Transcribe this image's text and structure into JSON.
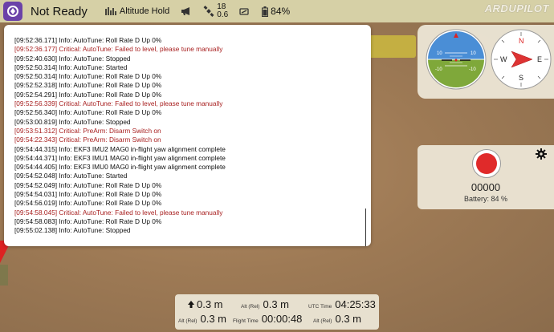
{
  "toolbar": {
    "title": "Not Ready",
    "flight_mode": "Altitude Hold",
    "satellites_top": "18",
    "satellites_bottom": "0.6",
    "battery": "84%",
    "brand": "ARDUPILOT"
  },
  "messages": [
    {
      "text": "[09:52:36.171] Info: AutoTune: Roll Rate D Up 0%",
      "level": "info"
    },
    {
      "text": "[09:52:36.177] Critical: AutoTune: Failed to level, please tune manually",
      "level": "critical"
    },
    {
      "text": "[09:52:40.630] Info: AutoTune: Stopped",
      "level": "info"
    },
    {
      "text": "[09:52:50.314] Info: AutoTune: Started",
      "level": "info"
    },
    {
      "text": "[09:52:50.314] Info: AutoTune: Roll Rate D Up 0%",
      "level": "info"
    },
    {
      "text": "[09:52:52.318] Info: AutoTune: Roll Rate D Up 0%",
      "level": "info"
    },
    {
      "text": "[09:52:54.291] Info: AutoTune: Roll Rate D Up 0%",
      "level": "info"
    },
    {
      "text": "[09:52:56.339] Critical: AutoTune: Failed to level, please tune manually",
      "level": "critical"
    },
    {
      "text": "[09:52:56.340] Info: AutoTune: Roll Rate D Up 0%",
      "level": "info"
    },
    {
      "text": "[09:53:00.819] Info: AutoTune: Stopped",
      "level": "info"
    },
    {
      "text": "[09:53:51.312] Critical: PreArm: Disarm Switch on",
      "level": "critical"
    },
    {
      "text": "[09:54:22.343] Critical: PreArm: Disarm Switch on",
      "level": "critical"
    },
    {
      "text": "[09:54:44.315] Info: EKF3 IMU2 MAG0 in-flight yaw alignment complete",
      "level": "info"
    },
    {
      "text": "[09:54:44.371] Info: EKF3 IMU1 MAG0 in-flight yaw alignment complete",
      "level": "info"
    },
    {
      "text": "[09:54:44.405] Info: EKF3 IMU0 MAG0 in-flight yaw alignment complete",
      "level": "info"
    },
    {
      "text": "[09:54:52.048] Info: AutoTune: Started",
      "level": "info"
    },
    {
      "text": "[09:54:52.049] Info: AutoTune: Roll Rate D Up 0%",
      "level": "info"
    },
    {
      "text": "[09:54:54.031] Info: AutoTune: Roll Rate D Up 0%",
      "level": "info"
    },
    {
      "text": "[09:54:56.019] Info: AutoTune: Roll Rate D Up 0%",
      "level": "info"
    },
    {
      "text": "[09:54:58.045] Critical: AutoTune: Failed to level, please tune manually",
      "level": "critical"
    },
    {
      "text": "[09:54:58.083] Info: AutoTune: Roll Rate D Up 0%",
      "level": "info"
    },
    {
      "text": "[09:55:02.138] Info: AutoTune: Stopped",
      "level": "info"
    }
  ],
  "attitude": {
    "pitch_labels": [
      "10",
      "10",
      "-10",
      "-10"
    ]
  },
  "compass": {
    "directions": [
      "N",
      "E",
      "S",
      "W"
    ]
  },
  "camera": {
    "count": "00000",
    "battery": "Battery: 84 %"
  },
  "telemetry": {
    "climb_value": "0.3 m",
    "alt_label": "Alt (Rel)",
    "alt_value": "0.3 m",
    "utc_label": "UTC Time",
    "utc_value": "04:25:33",
    "alt2_label": "Alt (Rel)",
    "alt2_value": "0.3 m",
    "flight_time_label": "Flight Time",
    "flight_time_value": "00:00:48",
    "alt3_label": "Alt (Rel)",
    "alt3_value": "0.3 m"
  },
  "colors": {
    "toolbar_bg": "#d6d0a6",
    "critical_text": "#a82020",
    "record_red": "#e02a2a",
    "logo_purple": "#6b42a8"
  }
}
